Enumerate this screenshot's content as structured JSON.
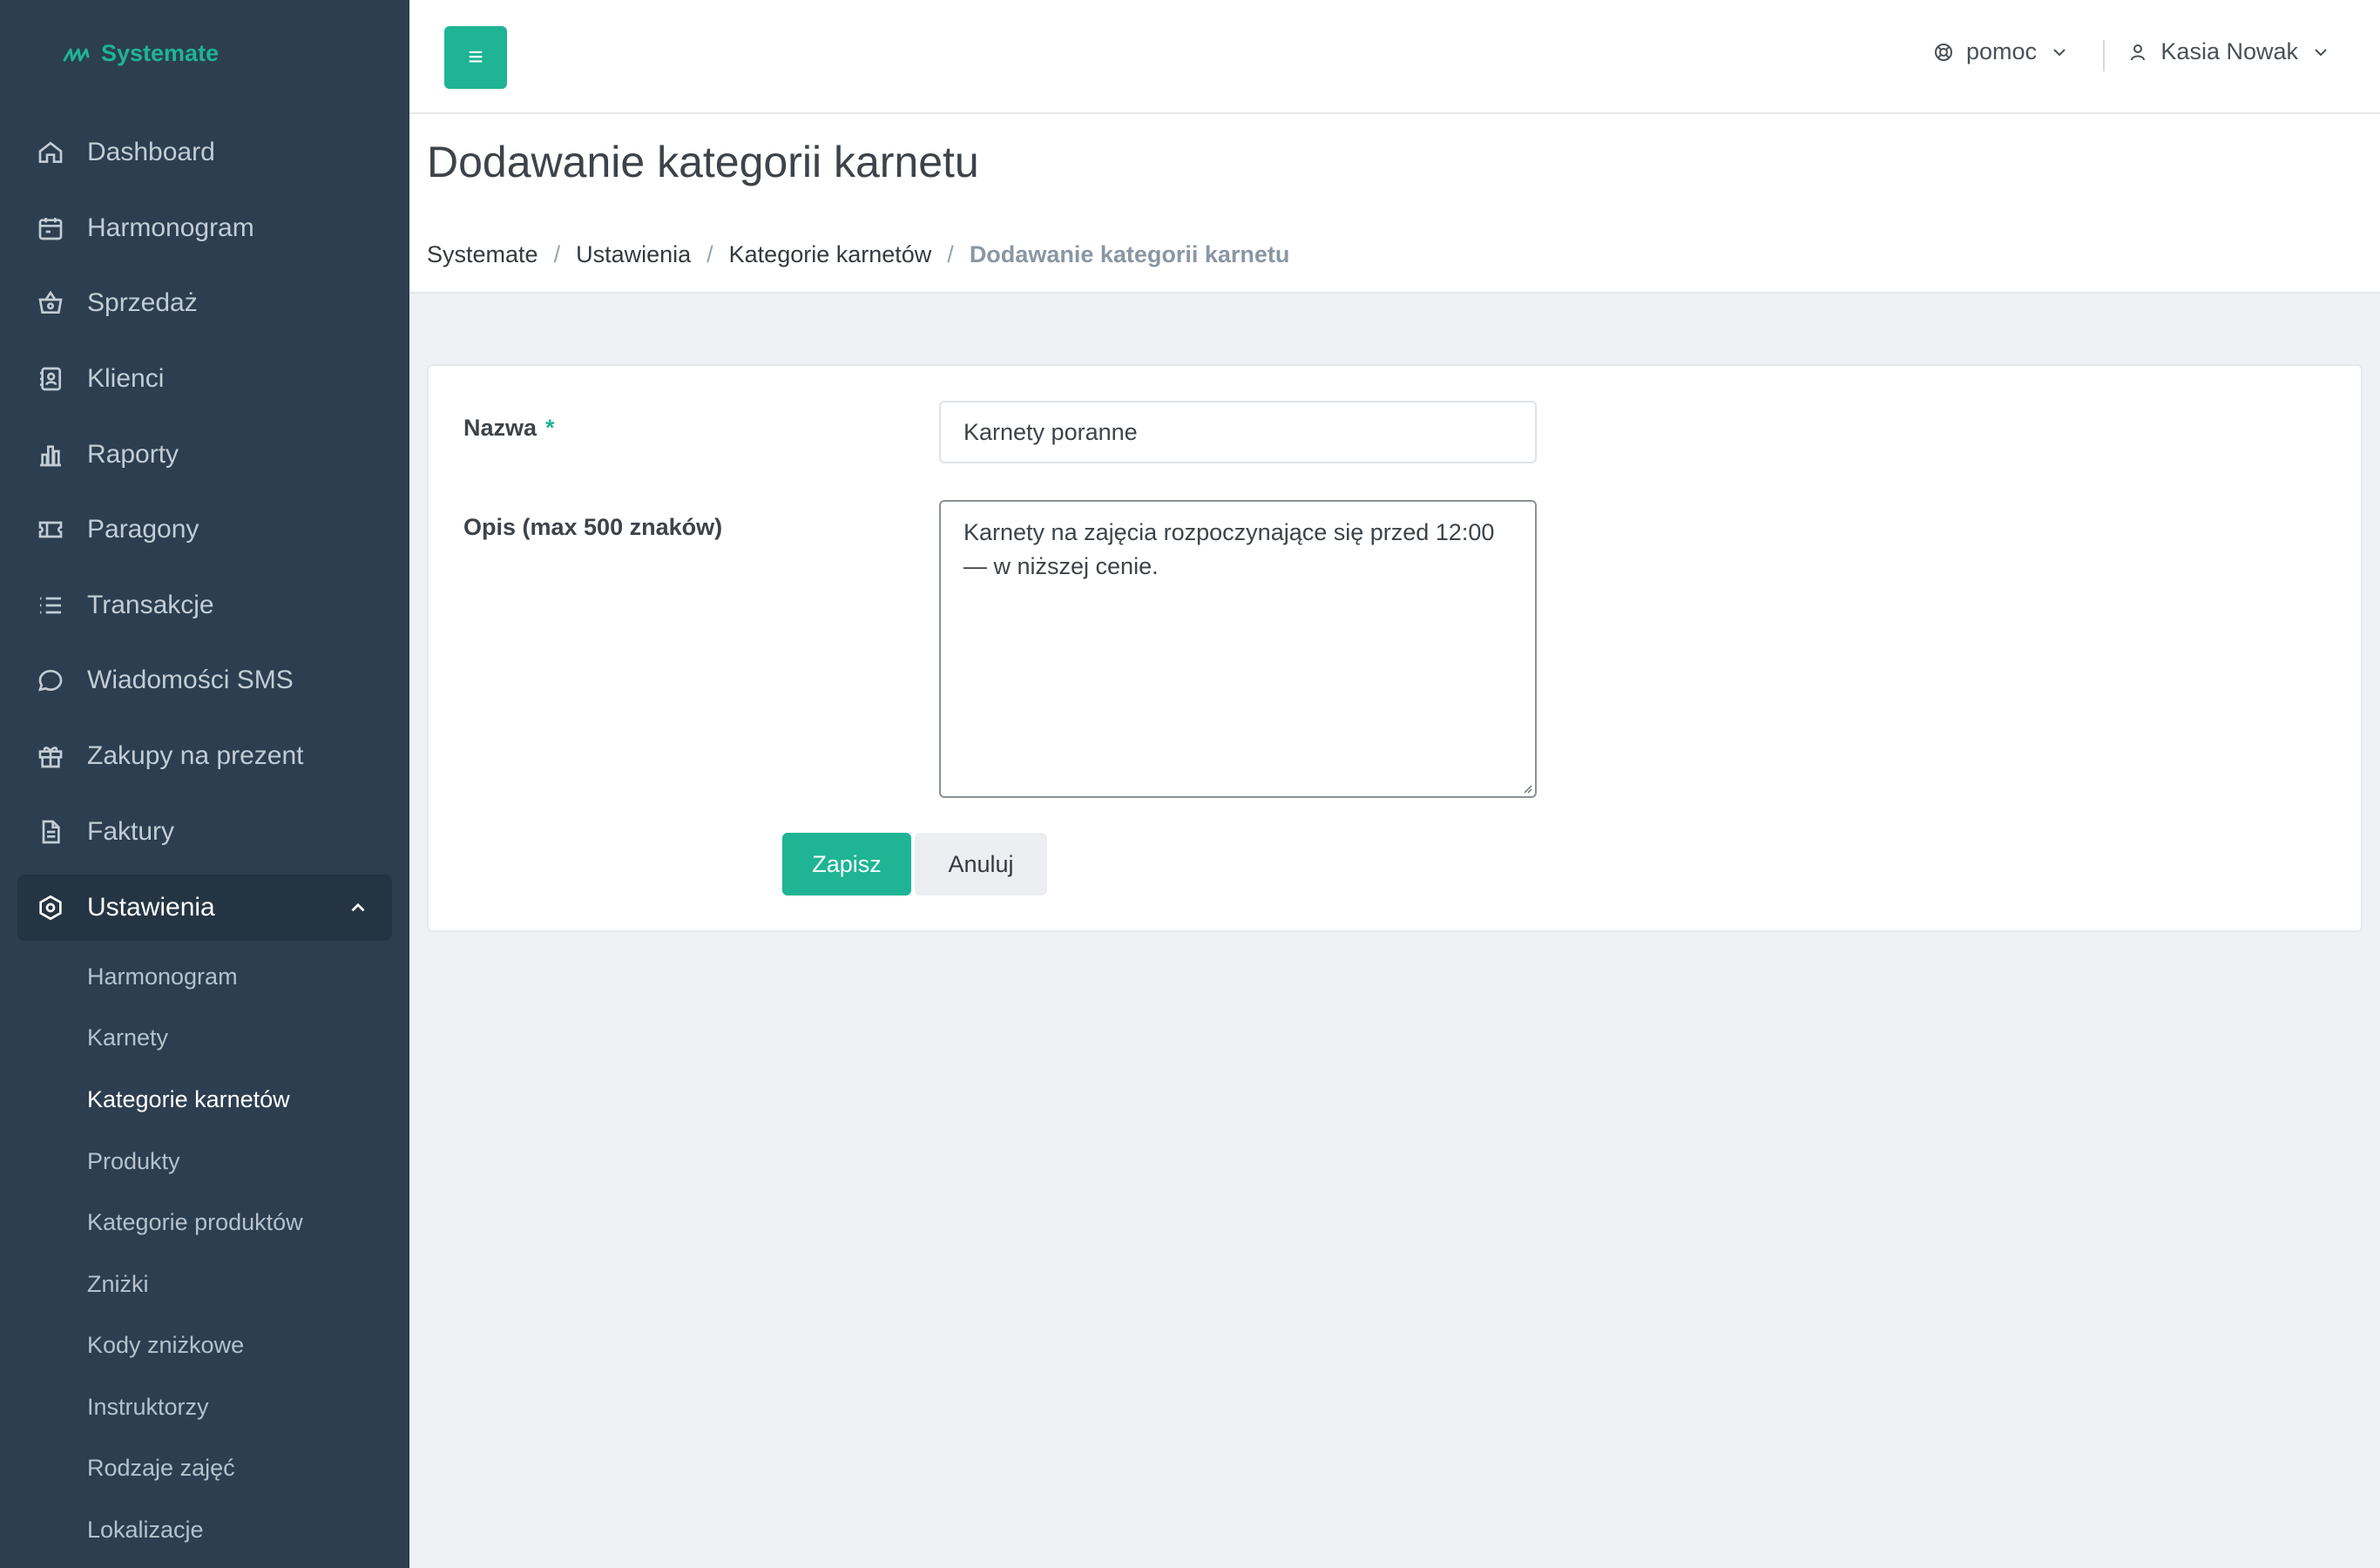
{
  "app": {
    "brand": "Systemate"
  },
  "sidebar": {
    "items": [
      {
        "label": "Dashboard",
        "icon": "home-icon"
      },
      {
        "label": "Harmonogram",
        "icon": "calendar-icon"
      },
      {
        "label": "Sprzedaż",
        "icon": "basket-icon"
      },
      {
        "label": "Klienci",
        "icon": "contacts-icon"
      },
      {
        "label": "Raporty",
        "icon": "bar-chart-icon"
      },
      {
        "label": "Paragony",
        "icon": "ticket-icon"
      },
      {
        "label": "Transakcje",
        "icon": "list-icon"
      },
      {
        "label": "Wiadomości SMS",
        "icon": "chat-bubble-icon"
      },
      {
        "label": "Zakupy na prezent",
        "icon": "gift-icon"
      },
      {
        "label": "Faktury",
        "icon": "document-icon"
      }
    ],
    "settings": {
      "label": "Ustawienia",
      "icon": "settings-hexagon-icon",
      "expanded": true,
      "subitems": [
        {
          "label": "Harmonogram"
        },
        {
          "label": "Karnety"
        },
        {
          "label": "Kategorie karnetów",
          "active": true
        },
        {
          "label": "Produkty"
        },
        {
          "label": "Kategorie produktów"
        },
        {
          "label": "Zniżki"
        },
        {
          "label": "Kody zniżkowe"
        },
        {
          "label": "Instruktorzy"
        },
        {
          "label": "Rodzaje zajęć"
        },
        {
          "label": "Lokalizacje"
        }
      ]
    }
  },
  "topbar": {
    "menu_icon": "≡",
    "help_label": "pomoc",
    "user_name": "Kasia Nowak"
  },
  "page": {
    "title": "Dodawanie kategorii karnetu",
    "breadcrumb": [
      "Systemate",
      "Ustawienia",
      "Kategorie karnetów",
      "Dodawanie kategorii karnetu"
    ]
  },
  "form": {
    "name_label": "Nazwa",
    "required_mark": "*",
    "name_value": "Karnety poranne",
    "desc_label": "Opis (max 500 znaków)",
    "desc_value": "Karnety na zajęcia rozpoczynające się przed 12:00 — w niższej cenie.",
    "save_label": "Zapisz",
    "cancel_label": "Anuluj"
  },
  "colors": {
    "accent": "#1eb494",
    "sidebar_bg": "#2c3e50",
    "page_bg": "#eff1f5"
  }
}
